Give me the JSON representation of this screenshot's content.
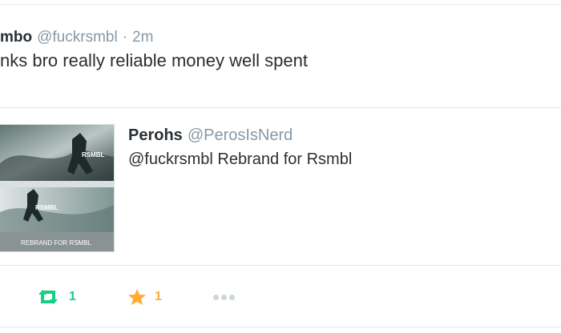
{
  "tweet": {
    "author_name": "mbo",
    "handle": "@fuckrsmbl",
    "separator": "·",
    "time": "2m",
    "text": "nks bro really reliable money well spent"
  },
  "quoted_tweet": {
    "author_name": "Perohs",
    "handle": "@PerosIsNerd",
    "text": "@fuckrsmbl Rebrand for Rsmbl",
    "image": {
      "top_label": "RSMBL",
      "bottom_label": "RSMBL",
      "caption": "REBRAND FOR RSMBL"
    }
  },
  "actions": {
    "retweet_count": "1",
    "favorite_count": "1"
  },
  "colors": {
    "retweet": "#19cf86",
    "favorite": "#ffac33",
    "muted": "#8899a6",
    "divider": "#e1e8ed"
  },
  "icons": [
    "retweet-icon",
    "star-icon",
    "more-options-icon"
  ]
}
